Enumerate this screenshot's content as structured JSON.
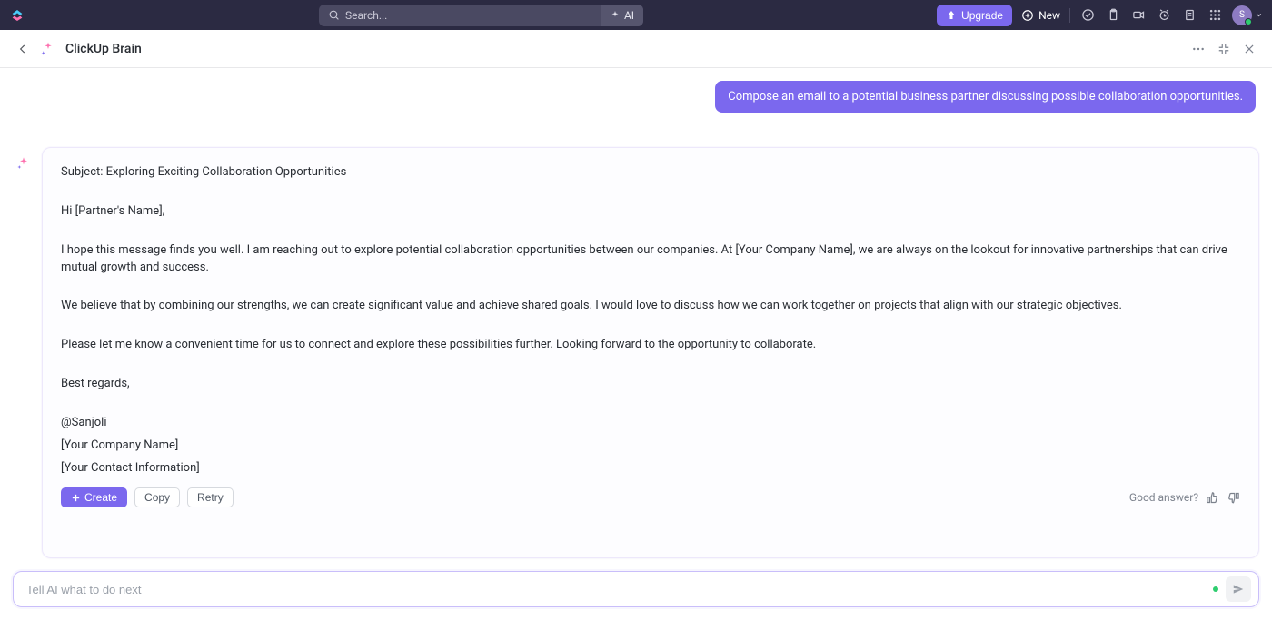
{
  "topbar": {
    "search_placeholder": "Search...",
    "ai_label": "AI",
    "upgrade_label": "Upgrade",
    "new_label": "New",
    "avatar_initial": "S"
  },
  "header": {
    "title": "ClickUp Brain"
  },
  "chat": {
    "user_message": "Compose an email to a potential business partner discussing possible collaboration opportunities.",
    "email": {
      "subject": "Subject: Exploring Exciting Collaboration Opportunities",
      "greeting": "Hi [Partner's Name],",
      "para1": "I hope this message finds you well. I am reaching out to explore potential collaboration opportunities between our companies. At [Your Company Name], we are always on the lookout for innovative partnerships that can drive mutual growth and success.",
      "para2": "We believe that by combining our strengths, we can create significant value and achieve shared goals. I would love to discuss how we can work together on projects that align with our strategic objectives.",
      "para3": "Please let me know a convenient time for us to connect and explore these possibilities further. Looking forward to the opportunity to collaborate.",
      "signoff": "Best regards,",
      "name": "@Sanjoli",
      "company": "[Your Company Name]",
      "contact": "[Your Contact Information]"
    },
    "actions": {
      "create": "Create",
      "copy": "Copy",
      "retry": "Retry",
      "feedback_label": "Good answer?"
    }
  },
  "input": {
    "placeholder": "Tell AI what to do next"
  }
}
